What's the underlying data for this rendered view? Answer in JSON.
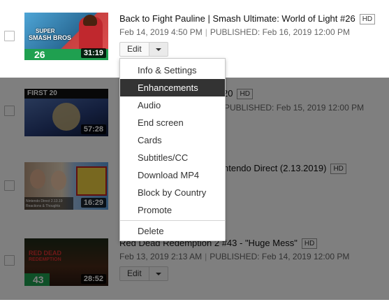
{
  "videos": [
    {
      "title": "Back to Fight Pauline | Smash Ultimate: World of Light #26",
      "hd": "HD",
      "recorded": "Feb 14, 2019 4:50 PM",
      "published": "PUBLISHED: Feb 16, 2019 12:00 PM",
      "duration": "31:19",
      "thumb_text": [
        "SUPER",
        "SMASH BROS",
        "26"
      ],
      "edit_label": "Edit"
    },
    {
      "title": "20",
      "hd": "HD",
      "published": "PUBLISHED: Feb 15, 2019 12:00 PM",
      "duration": "57:28",
      "thumb_text": [
        "FIRST 20"
      ]
    },
    {
      "title": "ntendo Direct (2.13.2019)",
      "hd": "HD",
      "duration": "16:29",
      "thumb_text": [
        "Nintendo Direct 2.13.19",
        "Reactions & Thoughts"
      ]
    },
    {
      "title": "Red Dead Redemption 2 #43 - \"Huge Mess\"",
      "hd": "HD",
      "recorded": "Feb 13, 2019 2:13 AM",
      "published": "PUBLISHED: Feb 14, 2019 12:00 PM",
      "duration": "28:52",
      "thumb_text": [
        "RED DEAD",
        "REDEMPTION",
        "43"
      ],
      "edit_label": "Edit"
    }
  ],
  "menu": {
    "items": [
      "Info & Settings",
      "Enhancements",
      "Audio",
      "End screen",
      "Cards",
      "Subtitles/CC",
      "Download MP4",
      "Block by Country",
      "Promote"
    ],
    "delete": "Delete",
    "active_index": 1
  },
  "colors": {
    "overlay": "rgba(0,0,0,0.5)",
    "menu_active_bg": "#333333"
  }
}
